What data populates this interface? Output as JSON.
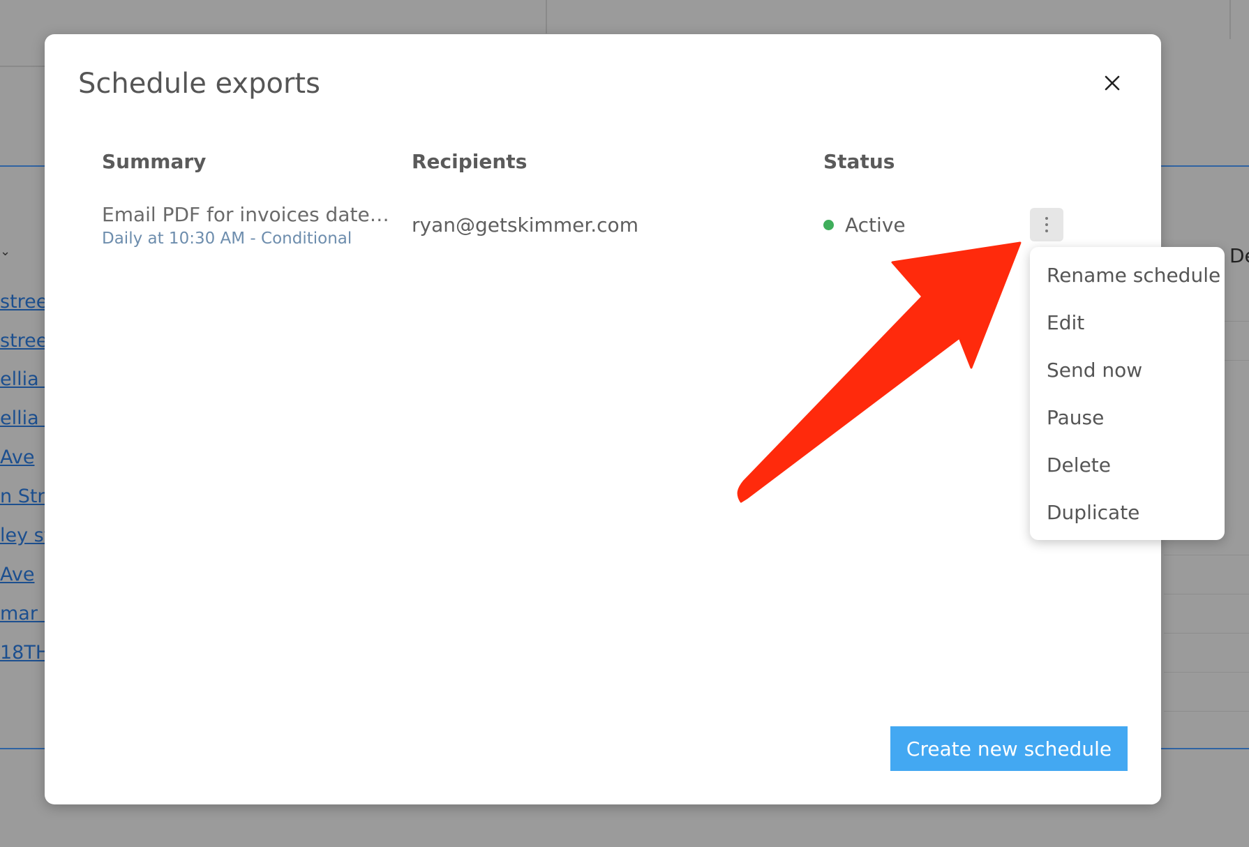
{
  "background": {
    "links": [
      "stree",
      "stree",
      "ellia V",
      "ellia V",
      "Ave",
      "n Stre",
      "ley st",
      "Ave",
      "mar B",
      "18TH"
    ],
    "header_right": "De"
  },
  "modal": {
    "title": "Schedule exports",
    "columns": {
      "summary": "Summary",
      "recipients": "Recipients",
      "status": "Status"
    },
    "row": {
      "summary_title": "Email PDF for invoices date…",
      "summary_subtitle": "Daily at 10:30 AM - Conditional",
      "recipient": "ryan@getskimmer.com",
      "status": "Active"
    },
    "create_button": "Create new schedule"
  },
  "menu": {
    "items": [
      "Rename schedule",
      "Edit",
      "Send now",
      "Pause",
      "Delete",
      "Duplicate"
    ]
  },
  "icons": {
    "close": "close-icon",
    "kebab": "more-vertical-icon",
    "status": "status-dot-icon",
    "annotation": "red-arrow-annotation"
  },
  "colors": {
    "primary_button": "#43a8f2",
    "status_active": "#3fae5b",
    "arrow": "#ff2a0c",
    "subtitle": "#6d8dad"
  }
}
